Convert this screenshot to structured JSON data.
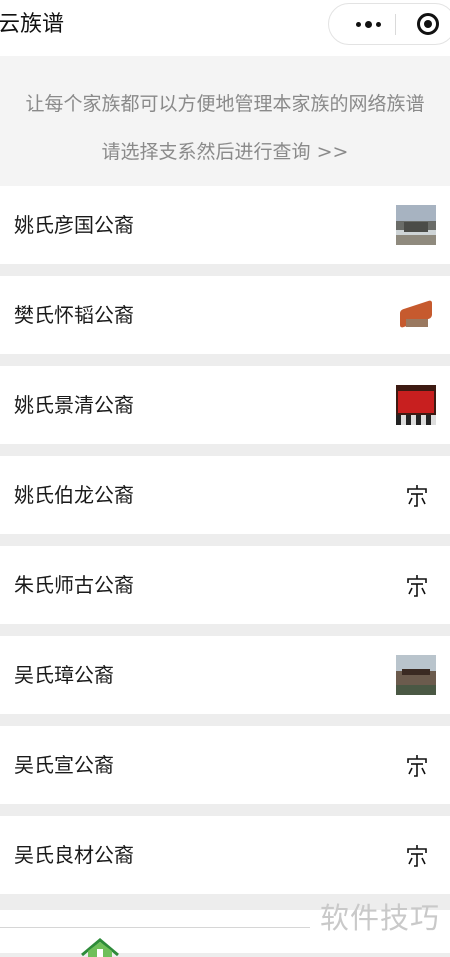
{
  "app": {
    "title": "云族谱"
  },
  "capsule": {
    "more_icon": "more-dots-icon",
    "close_icon": "target-circle-icon"
  },
  "banner": {
    "slogan": "让每个家族都可以方便地管理本家族的网络族谱",
    "hint": "请选择支系然后进行查询 >>"
  },
  "branches": [
    {
      "name": "姚氏彦国公裔",
      "icon": "house-photo"
    },
    {
      "name": "樊氏怀韬公裔",
      "icon": "temple-photo"
    },
    {
      "name": "姚氏景清公裔",
      "icon": "hall-photo"
    },
    {
      "name": "姚氏伯龙公裔",
      "icon": "clan-icon"
    },
    {
      "name": "朱氏师古公裔",
      "icon": "clan-icon"
    },
    {
      "name": "吴氏璋公裔",
      "icon": "building-photo"
    },
    {
      "name": "吴氏宣公裔",
      "icon": "clan-icon"
    },
    {
      "name": "吴氏良材公裔",
      "icon": "clan-icon"
    }
  ],
  "bottom": {
    "home_icon": "home-icon",
    "home_color": "#2e8b3a"
  },
  "watermark": "软件技巧",
  "colors": {
    "banner_text": "#8a8a8a",
    "separator": "#ededed"
  }
}
